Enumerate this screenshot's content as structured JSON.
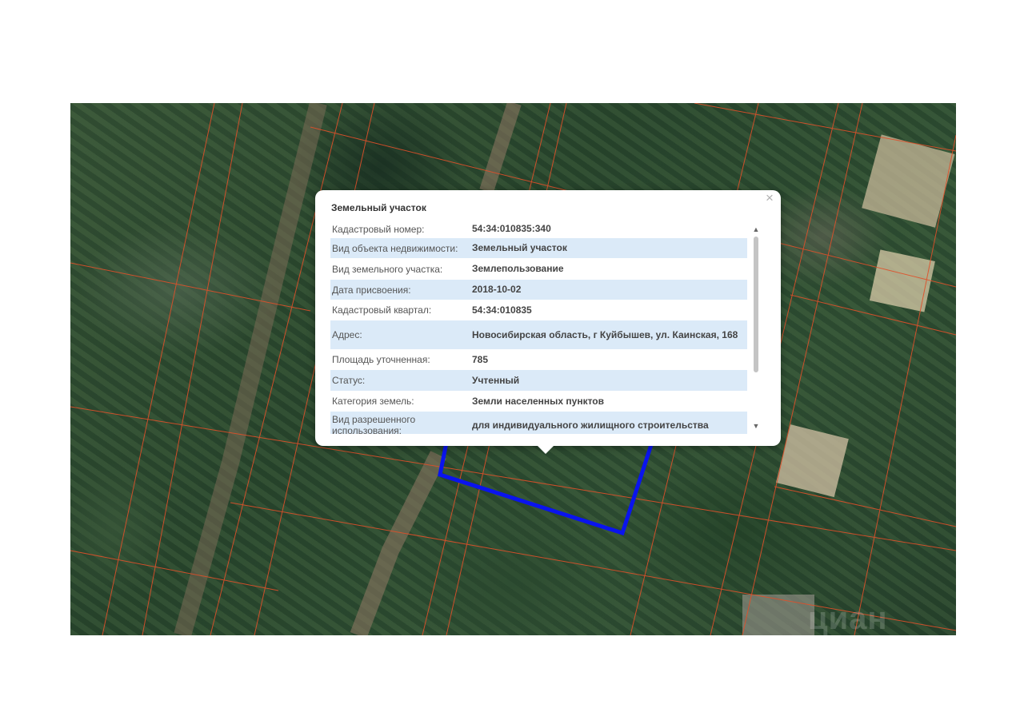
{
  "popup": {
    "title": "Земельный участок",
    "close_glyph": "×",
    "rows": [
      {
        "key": "Кадастровый номер:",
        "value": "54:34:010835:340"
      },
      {
        "key": "Вид объекта недвижимости:",
        "value": "Земельный участок"
      },
      {
        "key": "Вид земельного участка:",
        "value": "Землепользование"
      },
      {
        "key": "Дата присвоения:",
        "value": "2018-10-02"
      },
      {
        "key": "Кадастровый квартал:",
        "value": "54:34:010835"
      },
      {
        "key": "Адрес:",
        "value": "Новосибирская область, г Куйбышев, ул. Каинская, 168"
      },
      {
        "key": "Площадь уточненная:",
        "value": "785"
      },
      {
        "key": "Статус:",
        "value": "Учтенный"
      },
      {
        "key": "Категория земель:",
        "value": "Земли населенных пунктов"
      },
      {
        "key": "Вид разрешенного использования:",
        "value": "для индивидуального жилищного строительства"
      }
    ],
    "scroll_up_glyph": "▲",
    "scroll_down_glyph": "▼"
  },
  "watermark": "циан",
  "colors": {
    "parcel_outline": "#0a14ee",
    "cadastral_lines": "#e0502a",
    "row_highlight": "#dbeaf8"
  }
}
